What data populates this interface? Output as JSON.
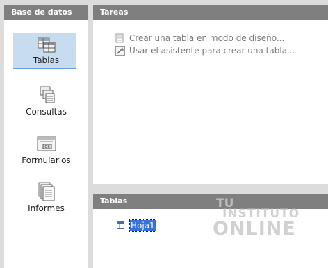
{
  "sidebar": {
    "title": "Base de datos",
    "items": [
      {
        "label": "Tablas",
        "icon": "tables-icon",
        "selected": true
      },
      {
        "label": "Consultas",
        "icon": "queries-icon",
        "selected": false
      },
      {
        "label": "Formularios",
        "icon": "forms-icon",
        "selected": false
      },
      {
        "label": "Informes",
        "icon": "reports-icon",
        "selected": false
      }
    ]
  },
  "tasks": {
    "title": "Tareas",
    "items": [
      {
        "label": "Crear una tabla en modo de diseño...",
        "icon": "design-table-icon"
      },
      {
        "label": "Usar el asistente para crear una tabla...",
        "icon": "wizard-icon"
      }
    ]
  },
  "tables": {
    "title": "Tablas",
    "items": [
      {
        "label": "Hoja1",
        "icon": "table-icon",
        "selected": true
      }
    ]
  },
  "watermark": {
    "line1": "TU",
    "line2": "INSTITUTO",
    "line3": "ONLINE"
  },
  "colors": {
    "header_bg": "#7f7f7f",
    "selection": "#3874d7",
    "nav_selection": "#c8dcf0"
  }
}
